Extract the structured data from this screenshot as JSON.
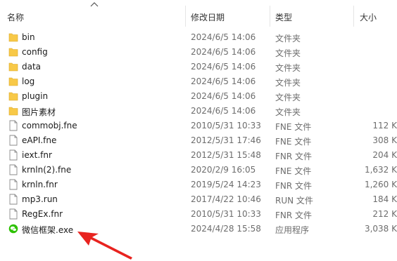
{
  "columns": {
    "name": "名称",
    "modified": "修改日期",
    "type": "类型",
    "size": "大小"
  },
  "sort_indicator": "chevron-up",
  "files": [
    {
      "name": "bin",
      "date": "2024/6/5 14:06",
      "type": "文件夹",
      "size": "",
      "icon": "folder-icon"
    },
    {
      "name": "config",
      "date": "2024/6/5 14:06",
      "type": "文件夹",
      "size": "",
      "icon": "folder-icon"
    },
    {
      "name": "data",
      "date": "2024/6/5 14:06",
      "type": "文件夹",
      "size": "",
      "icon": "folder-icon"
    },
    {
      "name": "log",
      "date": "2024/6/5 14:06",
      "type": "文件夹",
      "size": "",
      "icon": "folder-icon"
    },
    {
      "name": "plugin",
      "date": "2024/6/5 14:06",
      "type": "文件夹",
      "size": "",
      "icon": "folder-icon"
    },
    {
      "name": "图片素材",
      "date": "2024/6/5 14:06",
      "type": "文件夹",
      "size": "",
      "icon": "folder-icon"
    },
    {
      "name": "commobj.fne",
      "date": "2010/5/31 10:33",
      "type": "FNE 文件",
      "size": "112 K",
      "icon": "file-icon"
    },
    {
      "name": "eAPI.fne",
      "date": "2012/5/31 17:46",
      "type": "FNE 文件",
      "size": "308 K",
      "icon": "file-icon"
    },
    {
      "name": "iext.fnr",
      "date": "2012/5/31 15:48",
      "type": "FNR 文件",
      "size": "204 K",
      "icon": "file-icon"
    },
    {
      "name": "krnln(2).fne",
      "date": "2020/2/9 16:05",
      "type": "FNE 文件",
      "size": "1,632 K",
      "icon": "file-icon"
    },
    {
      "name": "krnln.fnr",
      "date": "2019/5/24 14:23",
      "type": "FNR 文件",
      "size": "1,260 K",
      "icon": "file-icon"
    },
    {
      "name": "mp3.run",
      "date": "2017/4/22 10:46",
      "type": "RUN 文件",
      "size": "184 K",
      "icon": "file-icon"
    },
    {
      "name": "RegEx.fnr",
      "date": "2010/5/31 10:33",
      "type": "FNR 文件",
      "size": "212 K",
      "icon": "file-icon"
    },
    {
      "name": "微信框架.exe",
      "date": "2024/4/28 15:58",
      "type": "应用程序",
      "size": "3,038 K",
      "icon": "wechat-icon"
    }
  ],
  "colors": {
    "folder": "#f8c948",
    "arrow": "#e8231f",
    "wechat": "#2dc100"
  }
}
